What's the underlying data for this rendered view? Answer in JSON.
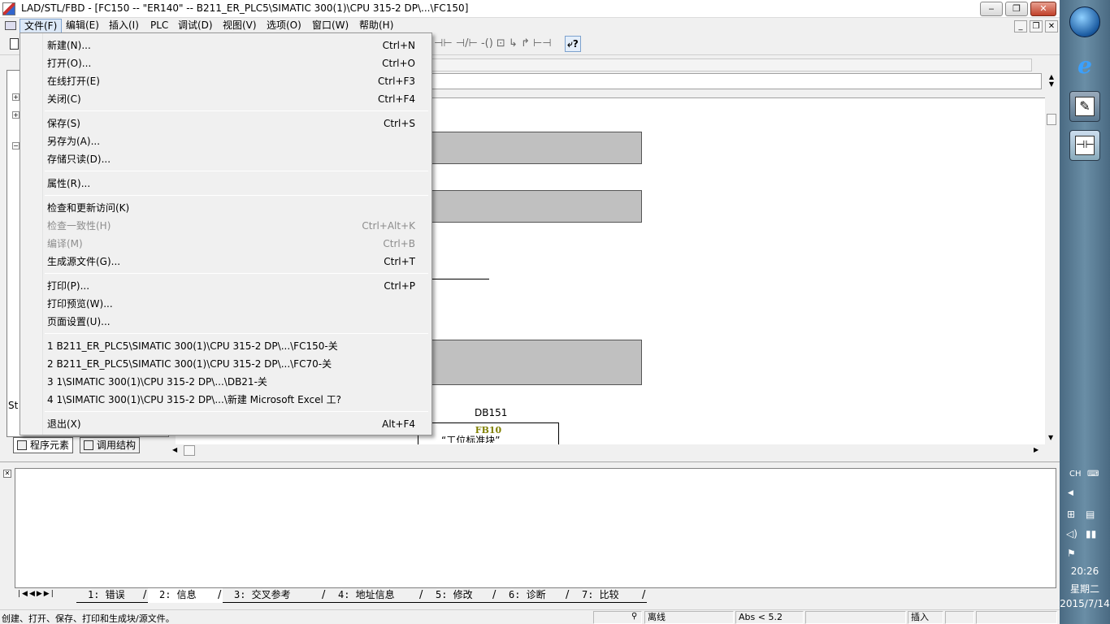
{
  "window": {
    "title": "LAD/STL/FBD  - [FC150 -- \"ER140\" -- B211_ER_PLC5\\SIMATIC 300(1)\\CPU 315-2 DP\\...\\FC150]",
    "minimize": "‒",
    "maximize": "❐",
    "close": "✕"
  },
  "menubar": {
    "items": [
      "文件(F)",
      "编辑(E)",
      "插入(I)",
      "PLC",
      "调试(D)",
      "视图(V)",
      "选项(O)",
      "窗口(W)",
      "帮助(H)"
    ],
    "mdi_minimize": "_",
    "mdi_restore": "❐",
    "mdi_close": "✕"
  },
  "toolbar": {
    "glyphs": "⊣⊢  ⊣/⊢  -()  ⊡  ↳  ↱  ⊢⊣",
    "help_glyph": "⤶?"
  },
  "file_menu": {
    "groups": [
      [
        {
          "label": "新建(N)...",
          "shortcut": "Ctrl+N",
          "disabled": false
        },
        {
          "label": "打开(O)...",
          "shortcut": "Ctrl+O",
          "disabled": false
        },
        {
          "label": "在线打开(E)",
          "shortcut": "Ctrl+F3",
          "disabled": false
        },
        {
          "label": "关闭(C)",
          "shortcut": "Ctrl+F4",
          "disabled": false
        }
      ],
      [
        {
          "label": "保存(S)",
          "shortcut": "Ctrl+S",
          "disabled": false
        },
        {
          "label": "另存为(A)...",
          "shortcut": "",
          "disabled": false
        },
        {
          "label": "存储只读(D)...",
          "shortcut": "",
          "disabled": false
        }
      ],
      [
        {
          "label": "属性(R)...",
          "shortcut": "",
          "disabled": false
        }
      ],
      [
        {
          "label": "检查和更新访问(K)",
          "shortcut": "",
          "disabled": false
        },
        {
          "label": "检查一致性(H)",
          "shortcut": "Ctrl+Alt+K",
          "disabled": true
        },
        {
          "label": "编译(M)",
          "shortcut": "Ctrl+B",
          "disabled": true
        },
        {
          "label": "生成源文件(G)...",
          "shortcut": "Ctrl+T",
          "disabled": false
        }
      ],
      [
        {
          "label": "打印(P)...",
          "shortcut": "Ctrl+P",
          "disabled": false
        },
        {
          "label": "打印预览(W)...",
          "shortcut": "",
          "disabled": false
        },
        {
          "label": "页面设置(U)...",
          "shortcut": "",
          "disabled": false
        }
      ],
      [
        {
          "label": "1 B211_ER_PLC5\\SIMATIC 300(1)\\CPU 315-2 DP\\...\\FC150-关",
          "shortcut": "",
          "disabled": false
        },
        {
          "label": "2 B211_ER_PLC5\\SIMATIC 300(1)\\CPU 315-2 DP\\...\\FC70-关",
          "shortcut": "",
          "disabled": false
        },
        {
          "label": "3 1\\SIMATIC 300(1)\\CPU 315-2 DP\\...\\DB21-关",
          "shortcut": "",
          "disabled": false
        },
        {
          "label": "4 1\\SIMATIC 300(1)\\CPU 315-2 DP\\...\\新建 Microsoft Excel 工?",
          "shortcut": "",
          "disabled": false
        }
      ],
      [
        {
          "label": "退出(X)",
          "shortcut": "Alt+F4",
          "disabled": false
        }
      ]
    ]
  },
  "left_panel": {
    "partial_label": "St",
    "tabs": [
      "程序元素",
      "调用结构"
    ]
  },
  "editor": {
    "db_label": "DB151",
    "fb_label": "FB10",
    "fb_comment": "“工位标准块”",
    "colors": {
      "block_fill": "#c0c0c0",
      "fb_color": "#808000"
    }
  },
  "bottom_tabs": [
    "1: 错误",
    "2: 信息",
    "3: 交叉参考",
    "4: 地址信息",
    "5: 修改",
    "6: 诊断",
    "7: 比较"
  ],
  "bottom_tabs_active": "2: 信息",
  "statusbar": {
    "message": "创建、打开、保存、打印和生成块/源文件。",
    "mode": "离线",
    "abs": "Abs < 5.2",
    "insert": "插入"
  },
  "taskbar": {
    "lang": "CH",
    "time": "20:26",
    "weekday": "星期二",
    "date": "2015/7/14"
  }
}
